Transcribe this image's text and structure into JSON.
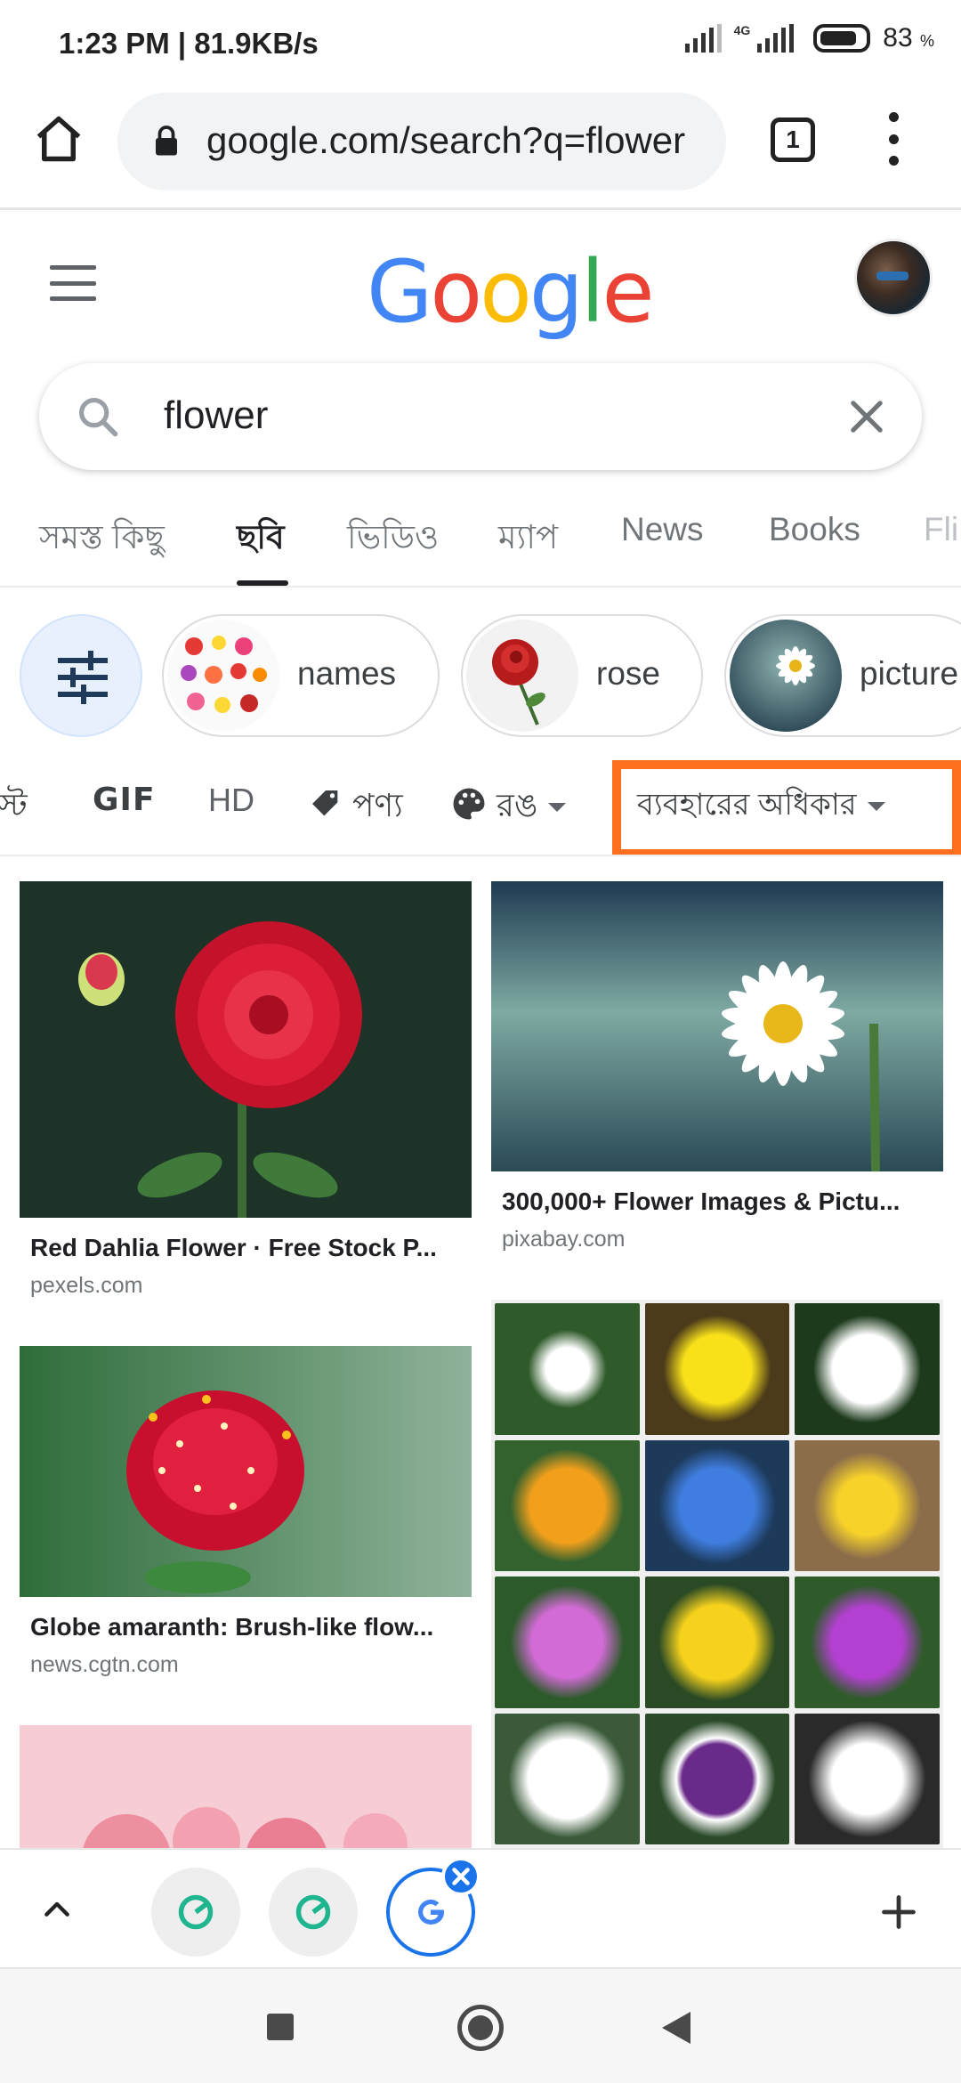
{
  "status_bar": {
    "time_speed": "1:23 PM | 81.9KB/s",
    "network": "4G",
    "battery_percent": "83",
    "battery_unit": "%",
    "battery_level": 0.83
  },
  "browser": {
    "url": "google.com/search?q=flower",
    "tab_count": "1"
  },
  "search": {
    "query": "flower"
  },
  "tabs": [
    {
      "label": "সমস্ত কিছু"
    },
    {
      "label": "ছবি",
      "active": true
    },
    {
      "label": "ভিডিও"
    },
    {
      "label": "ম্যাপ"
    },
    {
      "label": "News"
    },
    {
      "label": "Books"
    },
    {
      "label": "Fli"
    }
  ],
  "chips": [
    {
      "label": "names"
    },
    {
      "label": "rose"
    },
    {
      "label": "picture"
    }
  ],
  "filters": {
    "partial": "স্ট",
    "gif": "GIF",
    "hd": "HD",
    "product": "পণ্য",
    "color": "রঙ",
    "usage_rights": "ব্যবহারের অধিকার"
  },
  "results": [
    {
      "title": "Red Dahlia Flower · Free Stock P...",
      "source": "pexels.com"
    },
    {
      "title": "300,000+ Flower Images & Pictu...",
      "source": "pixabay.com"
    },
    {
      "title": "Globe amaranth: Brush-like flow...",
      "source": "news.cgtn.com"
    }
  ],
  "colors": {
    "highlight": "#ff6d1f",
    "accent": "#1a73e8"
  },
  "icons": [
    "home-icon",
    "lock-icon",
    "more-vert-icon",
    "hamburger-icon",
    "search-icon",
    "close-icon",
    "tune-icon",
    "tag-icon",
    "palette-icon",
    "chevron-up-icon",
    "plus-icon"
  ]
}
